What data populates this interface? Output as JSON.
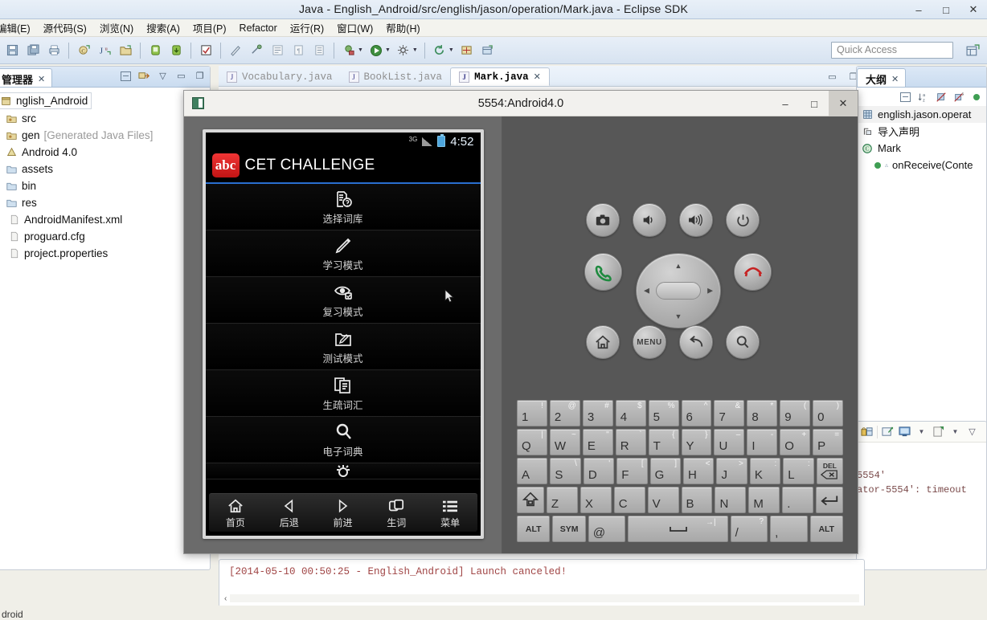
{
  "window": {
    "title": "Java  -  English_Android/src/english/jason/operation/Mark.java  -  Eclipse SDK",
    "minimize": "–",
    "maximize": "□",
    "close": "✕"
  },
  "menubar": {
    "items": [
      {
        "label": "编辑(E)"
      },
      {
        "label": "源代码(S)"
      },
      {
        "label": "浏览(N)"
      },
      {
        "label": "搜索(A)"
      },
      {
        "label": "项目(P)"
      },
      {
        "label": "Refactor"
      },
      {
        "label": "运行(R)"
      },
      {
        "label": "窗口(W)"
      },
      {
        "label": "帮助(H)"
      }
    ]
  },
  "toolbar": {
    "quick_access_placeholder": "Quick Access",
    "icons": [
      "save-icon",
      "save-all-icon",
      "print-icon",
      "new-class-icon",
      "new-junit-icon",
      "new-package-icon",
      "android-sdk-manager-icon",
      "android-avd-manager-icon",
      "toggle-mark-occurrences-icon",
      "quick-fix-icon",
      "annotation-icon",
      "next-annotation-icon",
      "previous-annotation-icon",
      "last-edit-icon",
      "debug-icon",
      "run-icon",
      "external-tools-icon",
      "refresh-icon",
      "new-window-icon",
      "open-perspective-icon"
    ],
    "perspective_icon": "open-perspective-icon"
  },
  "package_explorer": {
    "tab_label": "管理器",
    "tab_close": "✕",
    "tools": [
      "collapse-all-icon",
      "link-with-editor-icon",
      "view-menu-icon",
      "minimize-icon",
      "maximize-icon"
    ],
    "tree": [
      {
        "label": "nglish_Android",
        "icon": "java-project-icon",
        "root": true,
        "note": ""
      },
      {
        "label": "src",
        "icon": "source-folder-icon",
        "note": ""
      },
      {
        "label": "gen",
        "icon": "source-folder-icon",
        "note": "[Generated Java Files]"
      },
      {
        "label": "Android 4.0",
        "icon": "library-icon",
        "note": ""
      },
      {
        "label": "assets",
        "icon": "folder-icon",
        "note": ""
      },
      {
        "label": "bin",
        "icon": "folder-icon",
        "note": ""
      },
      {
        "label": "res",
        "icon": "folder-icon",
        "note": ""
      },
      {
        "label": "AndroidManifest.xml",
        "icon": "xml-file-icon",
        "note": ""
      },
      {
        "label": "proguard.cfg",
        "icon": "file-icon",
        "note": ""
      },
      {
        "label": "project.properties",
        "icon": "file-icon",
        "note": ""
      }
    ]
  },
  "editor": {
    "tabs": [
      {
        "label": "Vocabulary.java",
        "active": false
      },
      {
        "label": "BookList.java",
        "active": false
      },
      {
        "label": "Mark.java",
        "active": true,
        "close": "✕"
      }
    ],
    "tools": [
      "minimize-icon",
      "maximize-icon"
    ]
  },
  "outline": {
    "tab_label": "大纲",
    "tab_close": "✕",
    "tools": [
      "collapse-all-icon",
      "sort-icon",
      "hide-fields-icon",
      "hide-static-icon",
      "hide-nonpublic-icon"
    ],
    "items": [
      {
        "label": "english.jason.operat",
        "icon": "package-icon"
      },
      {
        "label": "导入声明",
        "icon": "import-declarations-icon"
      },
      {
        "label": "Mark",
        "icon": "class-icon"
      },
      {
        "label": "onReceive(Conte",
        "icon": "public-method-icon"
      }
    ]
  },
  "right_console": {
    "toolbar_icons": [
      "lock-scroll-icon",
      "pin-console-icon",
      "display-console-icon",
      "console-dropdown-icon",
      "new-console-icon",
      "console-options-icon",
      "view-menu-icon"
    ],
    "lines": [
      "5554'",
      "ator-5554': timeout"
    ]
  },
  "bottom_console": {
    "line": "[2014-05-10 00:50:25 - English_Android] Launch canceled!",
    "scroll_left": "‹"
  },
  "status_bar": {
    "text": "droid"
  },
  "emulator": {
    "title": "5554:Android4.0",
    "minimize": "–",
    "maximize": "□",
    "close": "✕",
    "window_icon": "emulator-icon",
    "phone": {
      "status_bar": {
        "network": "3G",
        "signal_icon": "signal-bars-icon",
        "battery_icon": "battery-icon",
        "clock": "4:52"
      },
      "app": {
        "logo_text": "abc",
        "logo_color": "#d81b1b",
        "title": "CET CHALLENGE",
        "accent_color": "#2a6fd0"
      },
      "menu_items": [
        {
          "label": "选择词库",
          "icon": "document-question-icon"
        },
        {
          "label": "学习模式",
          "icon": "pencil-icon"
        },
        {
          "label": "复习模式",
          "icon": "eye-check-icon"
        },
        {
          "label": "测试模式",
          "icon": "folder-pencil-icon"
        },
        {
          "label": "生疏词汇",
          "icon": "copy-documents-icon"
        },
        {
          "label": "电子词典",
          "icon": "magnifier-icon"
        },
        {
          "label": "",
          "icon": "gear-icon"
        }
      ],
      "navbar": [
        {
          "label": "首页",
          "icon": "home-icon"
        },
        {
          "label": "后退",
          "icon": "back-triangle-icon"
        },
        {
          "label": "前进",
          "icon": "forward-triangle-icon"
        },
        {
          "label": "生词",
          "icon": "windows-stack-icon"
        },
        {
          "label": "菜单",
          "icon": "list-menu-icon"
        }
      ]
    },
    "controls": [
      {
        "name": "camera-button",
        "icon": "camera-icon"
      },
      {
        "name": "volume-down-button",
        "icon": "volume-low-icon"
      },
      {
        "name": "volume-up-button",
        "icon": "volume-high-icon"
      },
      {
        "name": "power-button",
        "icon": "power-icon"
      },
      {
        "name": "call-button",
        "icon": "phone-green-icon"
      },
      {
        "name": "end-call-button",
        "icon": "phone-red-icon"
      },
      {
        "name": "home-button",
        "icon": "home-icon"
      },
      {
        "name": "menu-button",
        "icon": "menu-text-icon",
        "label": "MENU"
      },
      {
        "name": "back-button",
        "icon": "back-arrow-icon"
      },
      {
        "name": "search-button",
        "icon": "search-icon"
      }
    ],
    "dpad": {
      "up": "▲",
      "down": "▼",
      "left": "◀",
      "right": "▶",
      "center": "dpad-center-button"
    },
    "keyboard": {
      "rows": [
        [
          {
            "main": "1",
            "alt": "!"
          },
          {
            "main": "2",
            "alt": "@"
          },
          {
            "main": "3",
            "alt": "#"
          },
          {
            "main": "4",
            "alt": "$"
          },
          {
            "main": "5",
            "alt": "%"
          },
          {
            "main": "6",
            "alt": "^"
          },
          {
            "main": "7",
            "alt": "&"
          },
          {
            "main": "8",
            "alt": "*"
          },
          {
            "main": "9",
            "alt": "("
          },
          {
            "main": "0",
            "alt": ")"
          }
        ],
        [
          {
            "main": "Q",
            "alt": "|"
          },
          {
            "main": "W",
            "alt": "~"
          },
          {
            "main": "E",
            "alt": "\""
          },
          {
            "main": "R",
            "alt": "`"
          },
          {
            "main": "T",
            "alt": "{"
          },
          {
            "main": "Y",
            "alt": "}"
          },
          {
            "main": "U",
            "alt": "–"
          },
          {
            "main": "I",
            "alt": "-"
          },
          {
            "main": "O",
            "alt": "+"
          },
          {
            "main": "P",
            "alt": "="
          }
        ],
        [
          {
            "main": "A",
            "alt": ""
          },
          {
            "main": "S",
            "alt": "\\"
          },
          {
            "main": "D",
            "alt": "'"
          },
          {
            "main": "F",
            "alt": "["
          },
          {
            "main": "G",
            "alt": "]"
          },
          {
            "main": "H",
            "alt": "<"
          },
          {
            "main": "J",
            "alt": ">"
          },
          {
            "main": "K",
            "alt": ":"
          },
          {
            "main": "L",
            "alt": ":"
          },
          {
            "main": "DEL",
            "alt": "",
            "fn": "delete-key"
          }
        ],
        [
          {
            "main": "⇧",
            "alt": "",
            "fn": "shift-key"
          },
          {
            "main": "Z",
            "alt": ""
          },
          {
            "main": "X",
            "alt": ""
          },
          {
            "main": "C",
            "alt": ""
          },
          {
            "main": "V",
            "alt": ""
          },
          {
            "main": "B",
            "alt": ""
          },
          {
            "main": "N",
            "alt": ""
          },
          {
            "main": "M",
            "alt": ""
          },
          {
            "main": ".",
            "alt": ""
          },
          {
            "main": "↵",
            "alt": "",
            "fn": "enter-key"
          }
        ],
        [
          {
            "main": "ALT",
            "alt": "",
            "fn": "alt-left-key"
          },
          {
            "main": "SYM",
            "alt": "",
            "fn": "sym-key"
          },
          {
            "main": "@",
            "alt": ""
          },
          {
            "main": "␣",
            "alt": "→|",
            "fn": "space-key"
          },
          {
            "main": "/",
            "alt": "?"
          },
          {
            "main": ",",
            "alt": ""
          },
          {
            "main": "ALT",
            "alt": "",
            "fn": "alt-right-key"
          }
        ]
      ]
    }
  }
}
